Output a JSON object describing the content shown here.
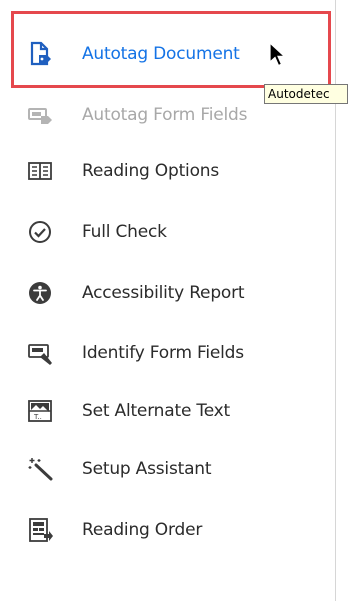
{
  "tools": {
    "items": [
      {
        "label": "Autotag Document",
        "icon": "autotag-document-icon",
        "state": "active"
      },
      {
        "label": "Autotag Form Fields",
        "icon": "autotag-form-fields-icon",
        "state": "disabled"
      },
      {
        "label": "Reading Options",
        "icon": "reading-options-icon",
        "state": "normal"
      },
      {
        "label": "Full Check",
        "icon": "full-check-icon",
        "state": "normal"
      },
      {
        "label": "Accessibility Report",
        "icon": "accessibility-report-icon",
        "state": "normal"
      },
      {
        "label": "Identify Form Fields",
        "icon": "identify-form-fields-icon",
        "state": "normal"
      },
      {
        "label": "Set Alternate Text",
        "icon": "set-alternate-text-icon",
        "state": "normal"
      },
      {
        "label": "Setup Assistant",
        "icon": "setup-assistant-icon",
        "state": "normal"
      },
      {
        "label": "Reading Order",
        "icon": "reading-order-icon",
        "state": "normal"
      }
    ]
  },
  "tooltip": {
    "text": "Autodetec"
  },
  "colors": {
    "accent": "#1473e6",
    "highlight_border": "#e5484d",
    "disabled": "#a8a8a8",
    "tooltip_bg": "#ffffe1"
  }
}
